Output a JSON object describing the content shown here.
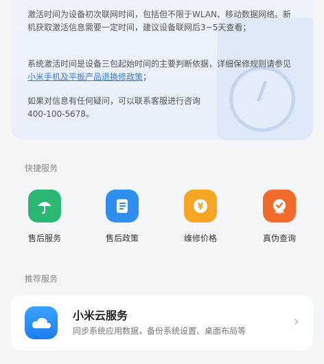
{
  "info": {
    "paragraph1": "激活时间为设备初次联网时间，包括但不限于WLAN、移动数据网络。新机获取激活信息需要一定时间，建议设备联网后3~5天查看；",
    "paragraph2_prefix": "系统激活时间是设备三包起始时间的主要判断依据，详细保修规则请参见",
    "paragraph2_link": "小米手机及平板产品退换修政策",
    "paragraph2_suffix": "；",
    "paragraph3_line1": "如果对信息有任何疑问，可以联系客服进行咨询",
    "paragraph3_line2": "400-100-5678。"
  },
  "quick_services": {
    "title": "快捷服务",
    "items": [
      {
        "label": "售后服务",
        "icon": "umbrella-icon",
        "color": "#2bb673"
      },
      {
        "label": "售后政策",
        "icon": "document-icon",
        "color": "#2f8ef0"
      },
      {
        "label": "维修价格",
        "icon": "yuan-coin-icon",
        "color": "#f5a623"
      },
      {
        "label": "真伪查询",
        "icon": "verified-badge-icon",
        "color": "#f26b2a"
      }
    ]
  },
  "recommended": {
    "title": "推荐服务",
    "item": {
      "title": "小米云服务",
      "description": "同步系统应用数据，备份系统设置、桌面布局等",
      "icon": "cloud-icon"
    }
  }
}
